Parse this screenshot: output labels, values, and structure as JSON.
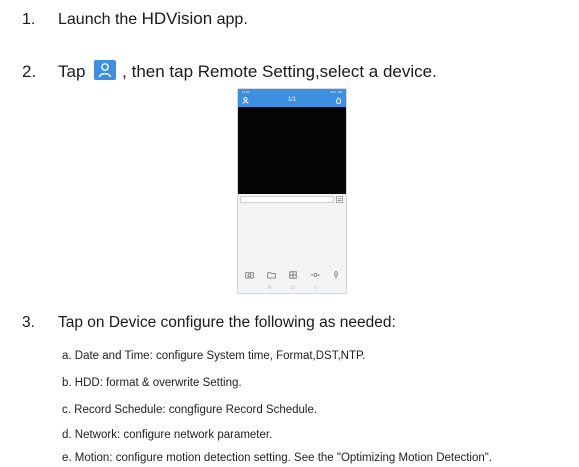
{
  "steps": {
    "s1": {
      "num": "1.",
      "pre": "Launch the ",
      "app": "HDVision",
      "post": " app."
    },
    "s2": {
      "num": "2.",
      "pre": "Tap",
      "post": ", then tap Remote Setting,select a device."
    },
    "s3": {
      "num": "3.",
      "text": "Tap on Device configure the following as needed:"
    }
  },
  "phone": {
    "status_time": "11:26",
    "status_right": "36.0 ▪ 88",
    "title": "1/1"
  },
  "icons": {
    "person_button": "person-icon",
    "home": "home-icon",
    "camera": "camera-icon",
    "folder": "folder-icon",
    "grid": "grid-icon",
    "ptz": "ptz-icon",
    "microphone": "microphone-icon"
  },
  "colors": {
    "accent": "#3d8fe0",
    "video": "#050505"
  },
  "sub_items": [
    "a. Date and Time: configure System time, Format,DST,NTP.",
    "b. HDD: format & overwrite Setting.",
    "c. Record Schedule: congfigure Record Schedule.",
    "d. Network: configure network parameter.",
    "e. Motion: configure motion detection setting. See the \"Optimizing Motion Detection\"."
  ]
}
